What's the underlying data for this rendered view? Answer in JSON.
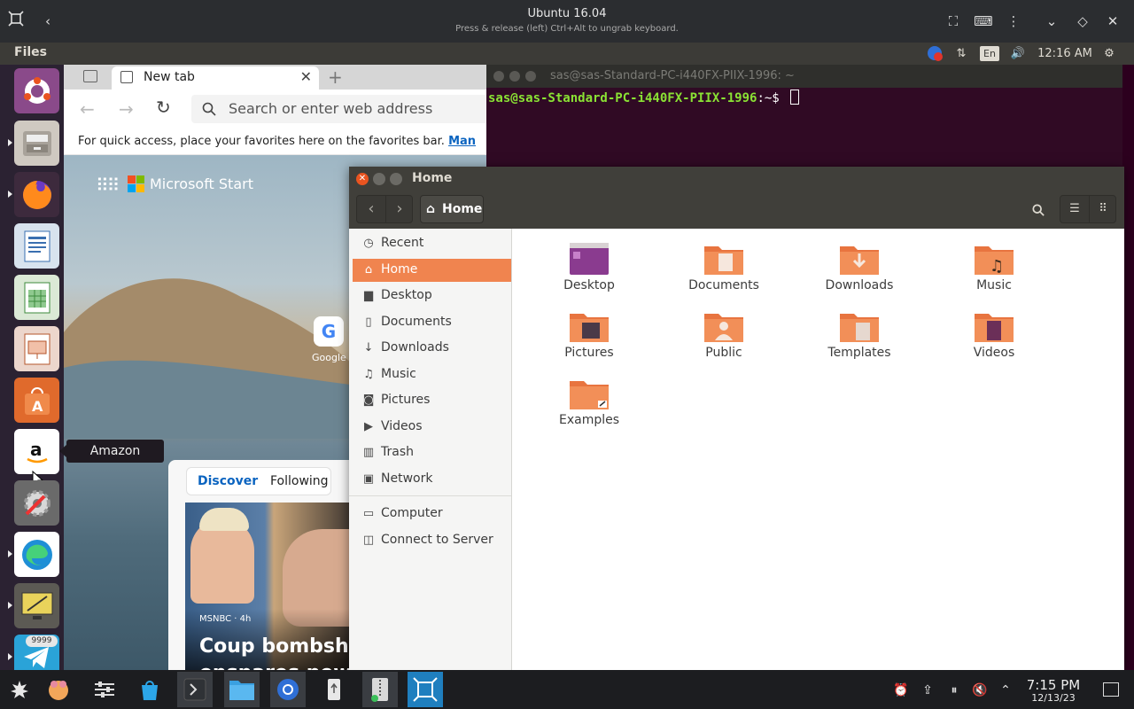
{
  "vm": {
    "title": "Ubuntu 16.04",
    "subtitle": "Press & release (left) Ctrl+Alt to ungrab keyboard."
  },
  "panel": {
    "app_name": "Files",
    "keyboard": "En",
    "time": "12:16 AM"
  },
  "launcher": {
    "tooltip": "Amazon",
    "telegram_badge": "9999"
  },
  "browser": {
    "tab_title": "New tab",
    "address_placeholder": "Search or enter web address",
    "favorites_text": "For quick access, place your favorites here on the favorites bar.",
    "favorites_link": "Man",
    "brand": "Microsoft Start",
    "google_label": "Google",
    "feed_tabs": [
      "Discover",
      "Following"
    ],
    "news_source": "MSNBC · 4h",
    "headline_1": "Coup bombshe",
    "headline_2": "ensnares new"
  },
  "terminal": {
    "title": "sas@sas-Standard-PC-i440FX-PIIX-1996: ~",
    "prompt_user": "sas@sas-Standard-PC-i440FX-PIIX-1996",
    "prompt_path": ":~$"
  },
  "files": {
    "title": "Home",
    "breadcrumb": "Home",
    "sidebar": [
      {
        "label": "Recent",
        "icon": "clock-icon"
      },
      {
        "label": "Home",
        "icon": "home-icon"
      },
      {
        "label": "Desktop",
        "icon": "folder-icon"
      },
      {
        "label": "Documents",
        "icon": "document-icon"
      },
      {
        "label": "Downloads",
        "icon": "download-icon"
      },
      {
        "label": "Music",
        "icon": "music-icon"
      },
      {
        "label": "Pictures",
        "icon": "camera-icon"
      },
      {
        "label": "Videos",
        "icon": "video-icon"
      },
      {
        "label": "Trash",
        "icon": "trash-icon"
      },
      {
        "label": "Network",
        "icon": "network-icon"
      },
      {
        "label": "Computer",
        "icon": "computer-icon"
      },
      {
        "label": "Connect to Server",
        "icon": "server-icon"
      }
    ],
    "items": [
      "Desktop",
      "Documents",
      "Downloads",
      "Music",
      "Pictures",
      "Public",
      "Templates",
      "Videos",
      "Examples"
    ]
  },
  "taskbar": {
    "time": "7:15 PM",
    "date": "12/13/23"
  },
  "colors": {
    "ubuntu_orange": "#f0844f",
    "terminal_bg": "#300a24",
    "panel_bg": "#3c3b37"
  }
}
